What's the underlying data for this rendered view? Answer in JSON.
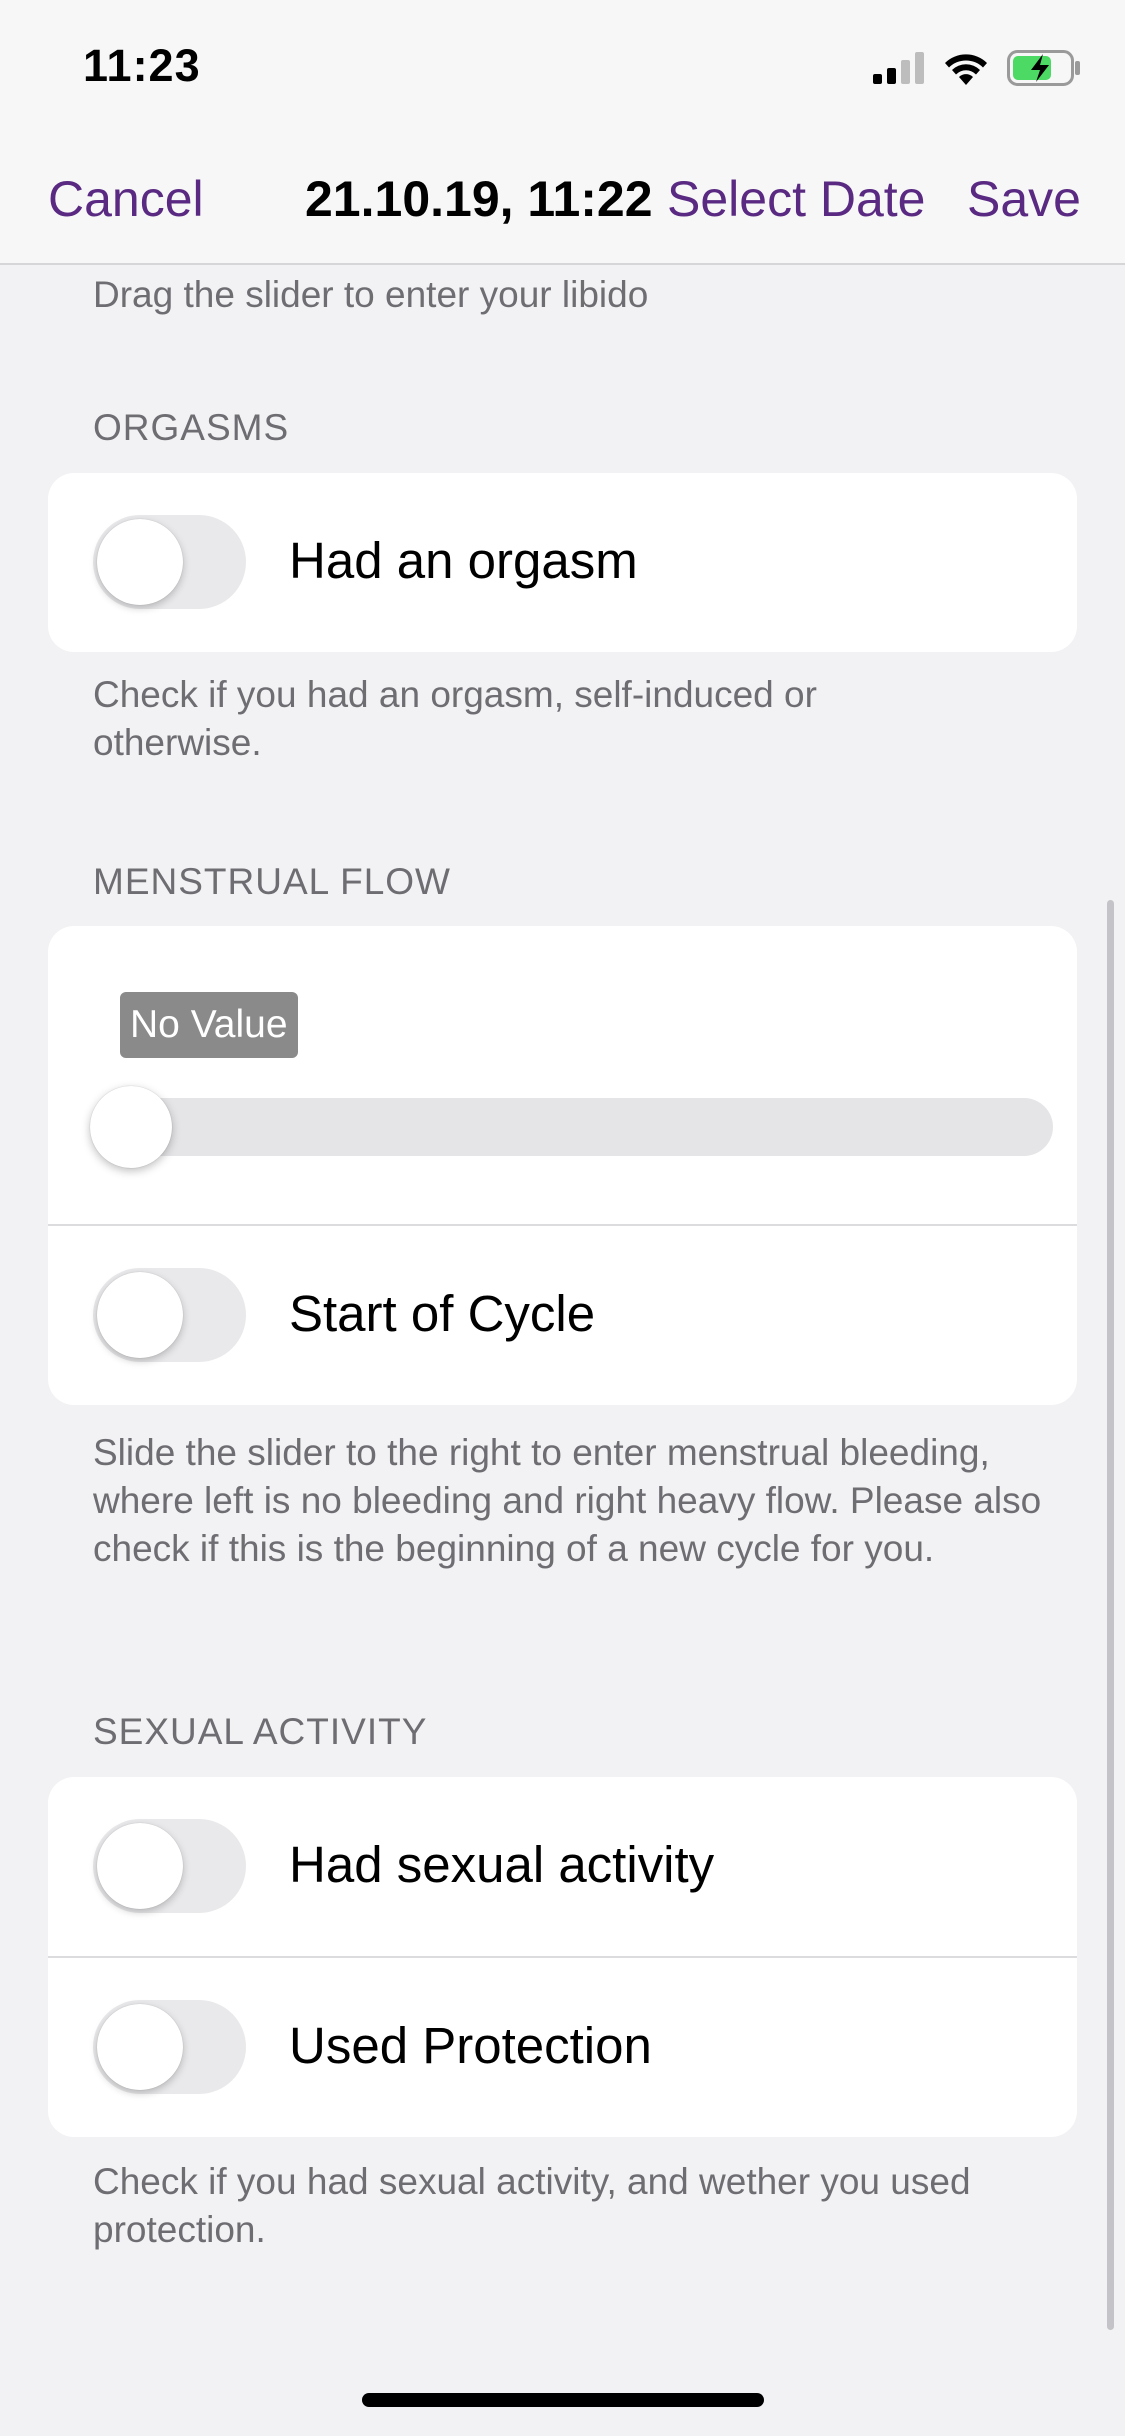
{
  "status_bar": {
    "time": "11:23",
    "icons": [
      "signal-icon",
      "wifi-icon",
      "battery-charging-icon"
    ]
  },
  "nav": {
    "cancel_label": "Cancel",
    "title": "21.10.19, 11:22",
    "select_date_label": "Select Date",
    "save_label": "Save",
    "accent_color": "#5a2a82"
  },
  "libido": {
    "footer": "Drag the slider to enter your libido"
  },
  "orgasms": {
    "header": "ORGASMS",
    "toggle_label": "Had an orgasm",
    "toggle_on": false,
    "footer": "Check if you had an orgasm, self-induced or otherwise."
  },
  "menstrual_flow": {
    "header": "MENSTRUAL FLOW",
    "slider_value_label": "No Value",
    "slider_fraction": 0,
    "cycle_label": "Start of Cycle",
    "cycle_on": false,
    "footer": "Slide the slider to the right to enter menstrual bleeding, where left is no bleeding and right heavy flow. Please also check if this is the beginning of a new cycle for you."
  },
  "sexual_activity": {
    "header": "SEXUAL ACTIVITY",
    "activity_label": "Had sexual activity",
    "activity_on": false,
    "protection_label": "Used Protection",
    "protection_on": false,
    "footer": "Check if you had sexual activity, and wether you used protection."
  }
}
